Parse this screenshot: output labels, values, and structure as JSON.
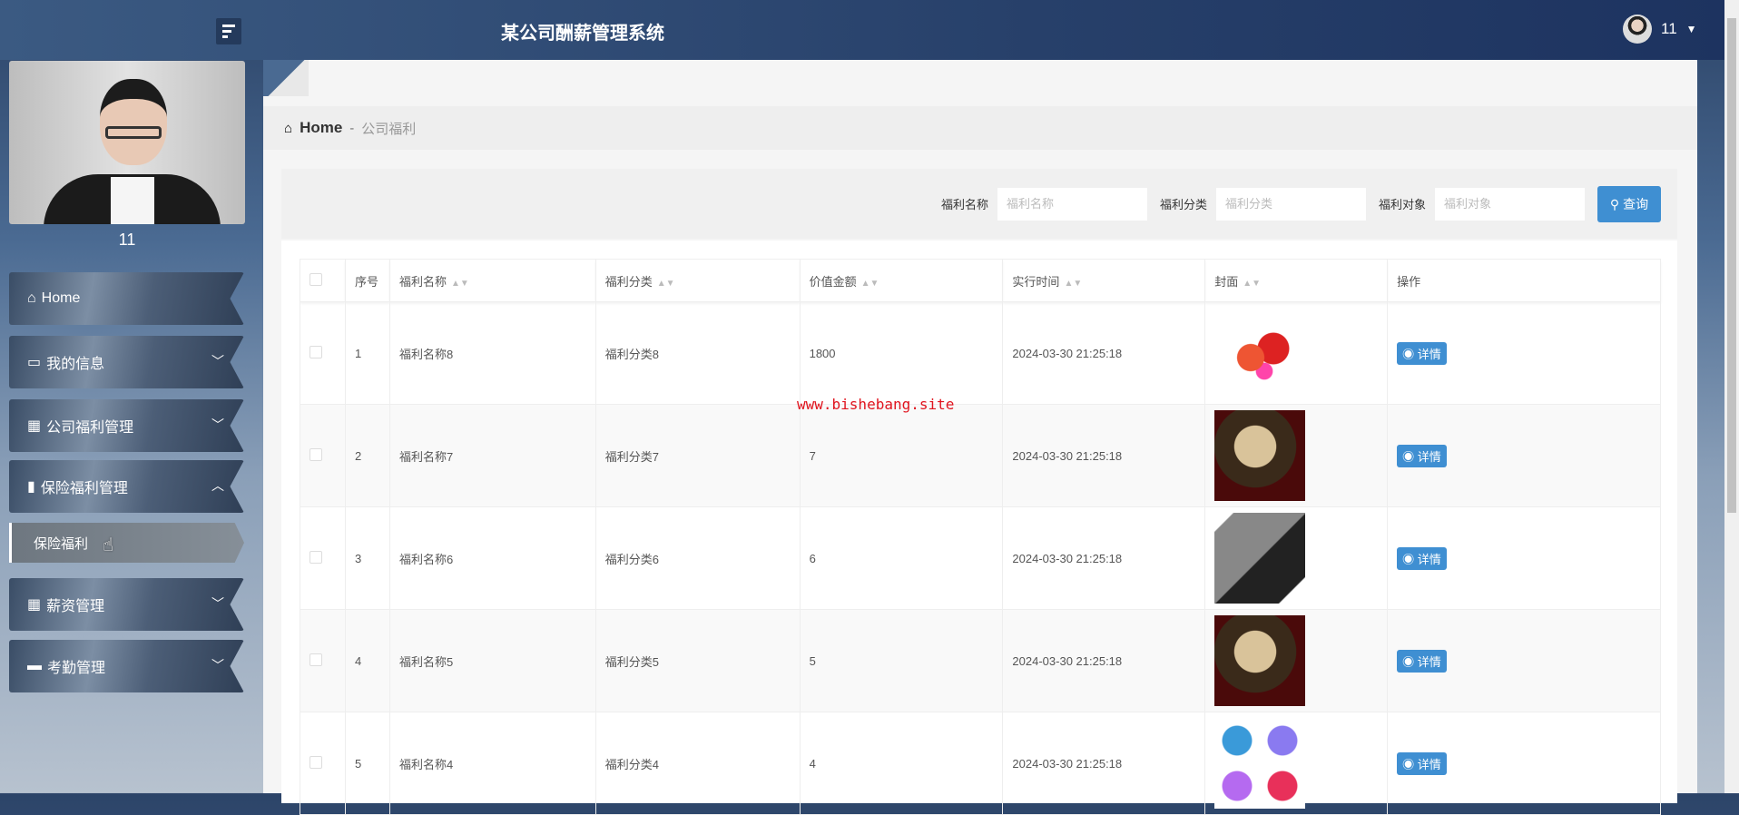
{
  "header": {
    "title": "某公司酬薪管理系统",
    "user": "11"
  },
  "sidebar": {
    "username": "11",
    "items": [
      {
        "label": "Home"
      },
      {
        "label": "我的信息"
      },
      {
        "label": "公司福利管理"
      },
      {
        "label": "保险福利管理"
      },
      {
        "label": "薪资管理"
      },
      {
        "label": "考勤管理"
      }
    ],
    "active_sub": "保险福利"
  },
  "breadcrumb": {
    "home": "Home",
    "sep": "-",
    "current": "公司福利"
  },
  "search": {
    "name_label": "福利名称",
    "name_placeholder": "福利名称",
    "cat_label": "福利分类",
    "cat_placeholder": "福利分类",
    "target_label": "福利对象",
    "target_placeholder": "福利对象",
    "button": "查询"
  },
  "table": {
    "headers": [
      "序号",
      "福利名称",
      "福利分类",
      "价值金额",
      "实行时间",
      "封面",
      "操作"
    ],
    "rows": [
      {
        "no": "1",
        "name": "福利名称8",
        "cat": "福利分类8",
        "value": "1800",
        "time": "2024-03-30 21:25:18",
        "action": "详情"
      },
      {
        "no": "2",
        "name": "福利名称7",
        "cat": "福利分类7",
        "value": "7",
        "time": "2024-03-30 21:25:18",
        "action": "详情"
      },
      {
        "no": "3",
        "name": "福利名称6",
        "cat": "福利分类6",
        "value": "6",
        "time": "2024-03-30 21:25:18",
        "action": "详情"
      },
      {
        "no": "4",
        "name": "福利名称5",
        "cat": "福利分类5",
        "value": "5",
        "time": "2024-03-30 21:25:18",
        "action": "详情"
      },
      {
        "no": "5",
        "name": "福利名称4",
        "cat": "福利分类4",
        "value": "4",
        "time": "2024-03-30 21:25:18",
        "action": "详情"
      }
    ]
  },
  "watermark": "www.bishebang.site"
}
